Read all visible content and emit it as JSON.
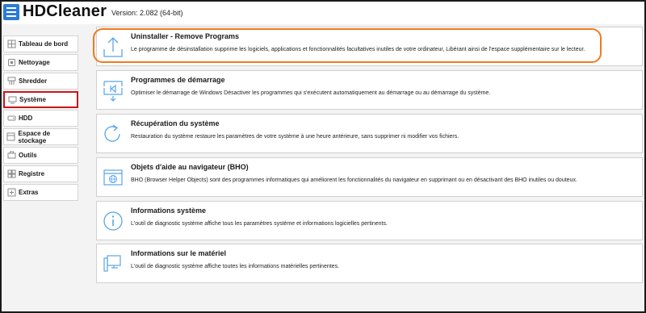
{
  "app": {
    "title": "HDCleaner",
    "version": "Version: 2.082 (64-bit)"
  },
  "sidebar": {
    "items": [
      {
        "label": "Tableau de bord",
        "icon": "home-icon"
      },
      {
        "label": "Nettoyage",
        "icon": "broom-icon"
      },
      {
        "label": "Shredder",
        "icon": "shredder-icon"
      },
      {
        "label": "Système",
        "icon": "system-icon",
        "active": true
      },
      {
        "label": "HDD",
        "icon": "hdd-icon"
      },
      {
        "label": "Espace de stockage",
        "icon": "storage-icon"
      },
      {
        "label": "Outils",
        "icon": "tools-icon"
      },
      {
        "label": "Registre",
        "icon": "registry-icon"
      },
      {
        "label": "Extras",
        "icon": "extras-icon"
      }
    ]
  },
  "cards": [
    {
      "title": "Uninstaller - Remove Programs",
      "desc": "Le programme de désinstallation supprime les logiciels, applications et fonctionnalités facultatives inutiles de votre ordinateur, Libérant ainsi de l'espace supplémentaire sur le lecteur.",
      "icon": "upload-icon"
    },
    {
      "title": "Programmes de démarrage",
      "desc": "Optimiser le démarrage de Windows Désactiver les programmes qui s'exécutent automatiquement au démarrage ou au démarrage du système.",
      "icon": "startup-icon"
    },
    {
      "title": "Récupération du système",
      "desc": "Restauration du système restaure les paramètres de votre système à une heure antérieure, sans supprimer ni modifier vos fichiers.",
      "icon": "restore-icon"
    },
    {
      "title": "Objets d'aide au navigateur (BHO)",
      "desc": "BHO (Browser Helper Objects) sont des programmes informatiques qui améliorent les fonctionnalités du navigateur en supprimant ou en désactivant des BHO inutiles ou douteux.",
      "icon": "browser-icon"
    },
    {
      "title": "Informations système",
      "desc": "L'outil de diagnostic système affiche tous les paramètres système et informations logicielles pertinents.",
      "icon": "info-icon"
    },
    {
      "title": "Informations sur le matériel",
      "desc": "L'outil de diagnostic système affiche toutes les informations matérielles pertinentes.",
      "icon": "hardware-icon"
    }
  ],
  "colors": {
    "accent": "#2b7bd6",
    "highlight": "#f07a1e",
    "active_border": "#c8161d"
  }
}
